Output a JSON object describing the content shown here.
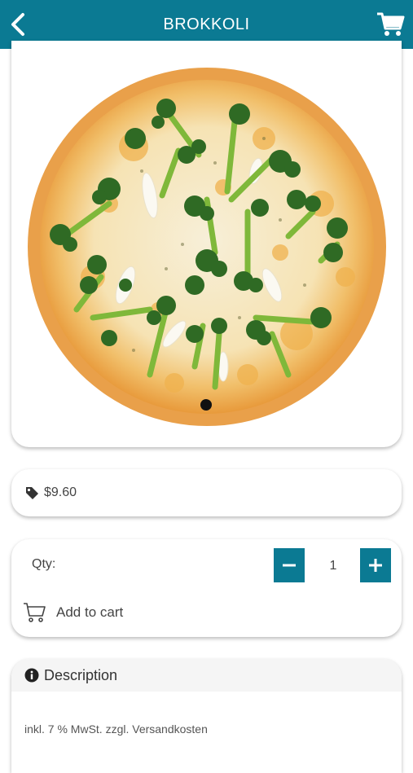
{
  "header": {
    "title": "BROKKOLI",
    "back_icon": "chevron-left-icon",
    "cart_icon": "shopping-cart-icon",
    "background": "#0b7a93"
  },
  "product": {
    "image_alt": "Broccoli pizza",
    "image_position": "1 of 1",
    "price": "$9.60",
    "price_icon": "tag-icon"
  },
  "quantity": {
    "label": "Qty:",
    "value": "1",
    "minus_label": "−",
    "plus_label": "+",
    "add_to_cart_label": "Add to cart",
    "add_to_cart_icon": "cart-outline-icon"
  },
  "description": {
    "title": "Description",
    "info_icon": "info-icon",
    "text": "inkl. 7 % MwSt. zzgl. Versandkosten"
  },
  "colors": {
    "accent": "#0b7a93"
  }
}
